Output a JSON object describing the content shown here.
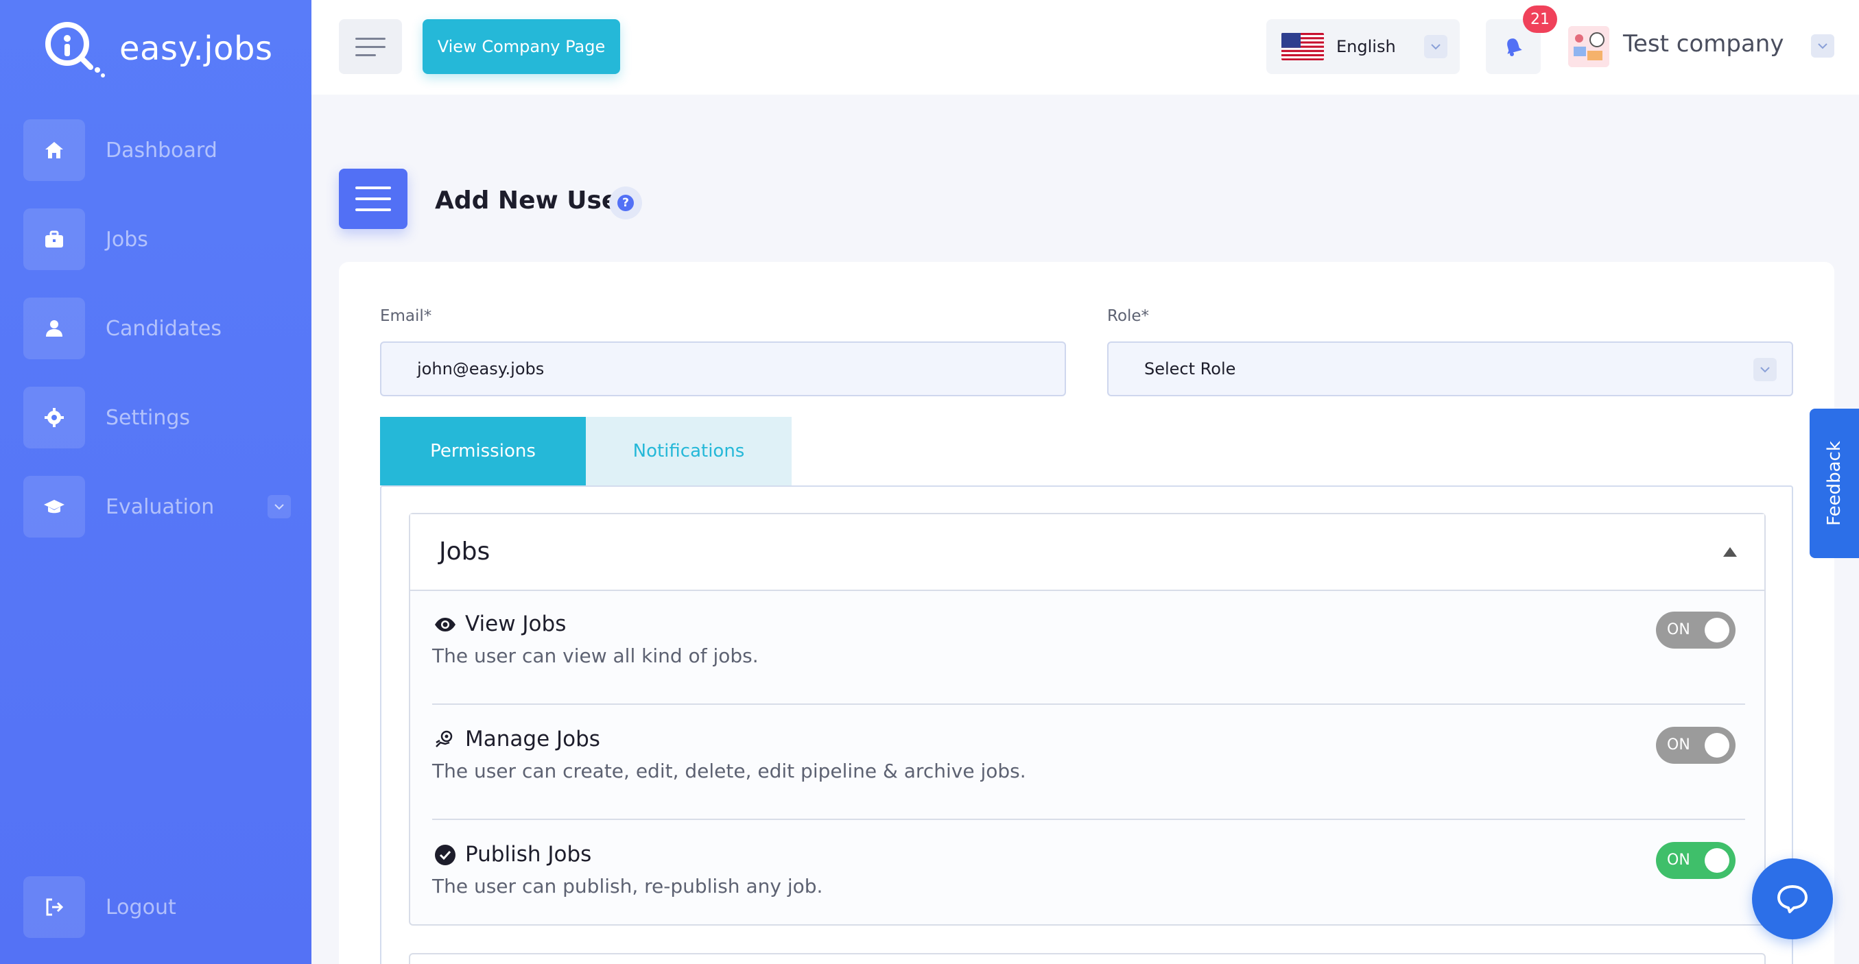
{
  "brand": {
    "name": "easy.jobs"
  },
  "sidebar": {
    "items": [
      {
        "label": "Dashboard",
        "icon": "home-icon"
      },
      {
        "label": "Jobs",
        "icon": "briefcase-icon"
      },
      {
        "label": "Candidates",
        "icon": "user-icon"
      },
      {
        "label": "Settings",
        "icon": "gear-icon"
      },
      {
        "label": "Evaluation",
        "icon": "graduation-cap-icon"
      }
    ],
    "logout": {
      "label": "Logout",
      "icon": "logout-icon"
    }
  },
  "topbar": {
    "view_company_label": "View Company Page",
    "language": "English",
    "notification_count": "21",
    "company_name": "Test company"
  },
  "page": {
    "title": "Add New User",
    "help_symbol": "?"
  },
  "form": {
    "email": {
      "label": "Email*",
      "value": "john@easy.jobs"
    },
    "role": {
      "label": "Role*",
      "value": "Select Role"
    }
  },
  "tabs": [
    {
      "label": "Permissions",
      "active": true
    },
    {
      "label": "Notifications",
      "active": false
    }
  ],
  "jobs_section": {
    "title": "Jobs",
    "permissions": [
      {
        "title": "View Jobs",
        "description": "The user can view all kind of jobs.",
        "toggle_label": "ON",
        "enabled": false,
        "icon": "eye-icon"
      },
      {
        "title": "Manage Jobs",
        "description": "The user can create, edit, delete, edit pipeline & archive jobs.",
        "toggle_label": "ON",
        "enabled": false,
        "icon": "manage-hand-icon"
      },
      {
        "title": "Publish Jobs",
        "description": "The user can publish, re-publish any job.",
        "toggle_label": "ON",
        "enabled": true,
        "icon": "check-circle-icon"
      }
    ]
  },
  "feedback_label": "Feedback",
  "colors": {
    "sidebar": "#5472f5",
    "accent_cyan": "#25b8d8",
    "primary_blue": "#5270f5",
    "toggle_on": "#3fbf6a",
    "toggle_off": "#9b9b9b",
    "badge_red": "#f0415a",
    "chat_blue": "#2c6fe8"
  }
}
